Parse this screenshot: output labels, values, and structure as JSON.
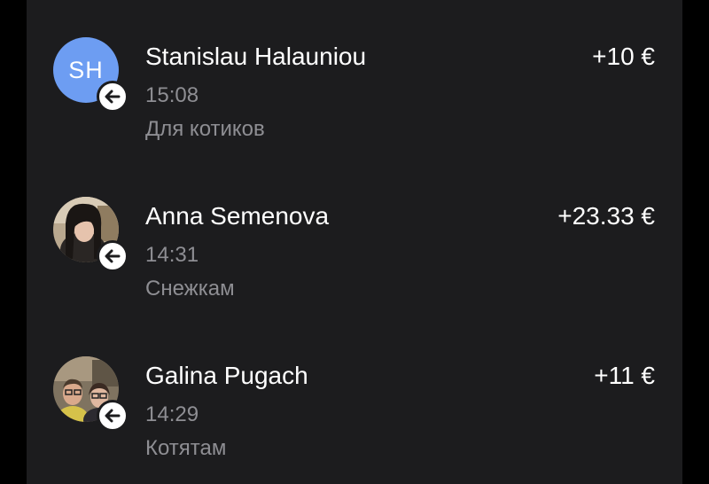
{
  "colors": {
    "background": "#000000",
    "panel": "#1c1c1e",
    "primary_text": "#ffffff",
    "secondary_text": "#8e8e93",
    "initials_avatar": "#6d9df2",
    "badge": "#ffffff"
  },
  "transactions": [
    {
      "avatar_initials": "SH",
      "badge_icon": "arrow-left-icon",
      "name": "Stanislau Halauniou",
      "time": "15:08",
      "note": "Для котиков",
      "amount": "+10 €"
    },
    {
      "avatar_icon": "avatar-photo",
      "badge_icon": "arrow-left-icon",
      "name": "Anna Semenova",
      "time": "14:31",
      "note": "Снежкам",
      "amount": "+23.33 €"
    },
    {
      "avatar_icon": "avatar-photo",
      "badge_icon": "arrow-left-icon",
      "name": "Galina Pugach",
      "time": "14:29",
      "note": "Котятам",
      "amount": "+11 €"
    }
  ]
}
